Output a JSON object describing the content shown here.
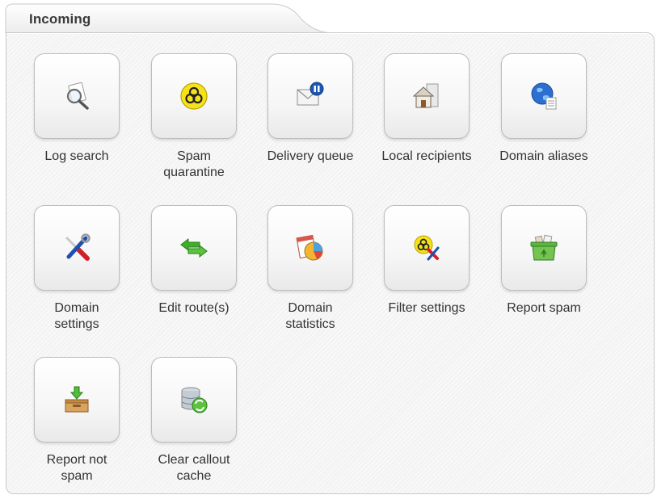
{
  "header": {
    "title": "Incoming"
  },
  "tiles": [
    {
      "label": "Log search",
      "icon": "magnifier-document-icon"
    },
    {
      "label": "Spam\nquarantine",
      "icon": "biohazard-icon"
    },
    {
      "label": "Delivery queue",
      "icon": "envelope-pause-icon"
    },
    {
      "label": "Local recipients",
      "icon": "house-icon"
    },
    {
      "label": "Domain aliases",
      "icon": "globe-document-icon"
    },
    {
      "label": "Domain\nsettings",
      "icon": "wrench-screwdriver-icon"
    },
    {
      "label": "Edit route(s)",
      "icon": "green-arrows-icon"
    },
    {
      "label": "Domain\nstatistics",
      "icon": "pie-chart-icon"
    },
    {
      "label": "Filter settings",
      "icon": "biohazard-tools-icon"
    },
    {
      "label": "Report spam",
      "icon": "recycle-bin-icon"
    },
    {
      "label": "Report not\nspam",
      "icon": "inbox-download-icon"
    },
    {
      "label": "Clear callout\ncache",
      "icon": "database-refresh-icon"
    }
  ],
  "colors": {
    "panel_bg": "#f3f3f3",
    "border": "#c9c9c9",
    "text": "#333333"
  }
}
